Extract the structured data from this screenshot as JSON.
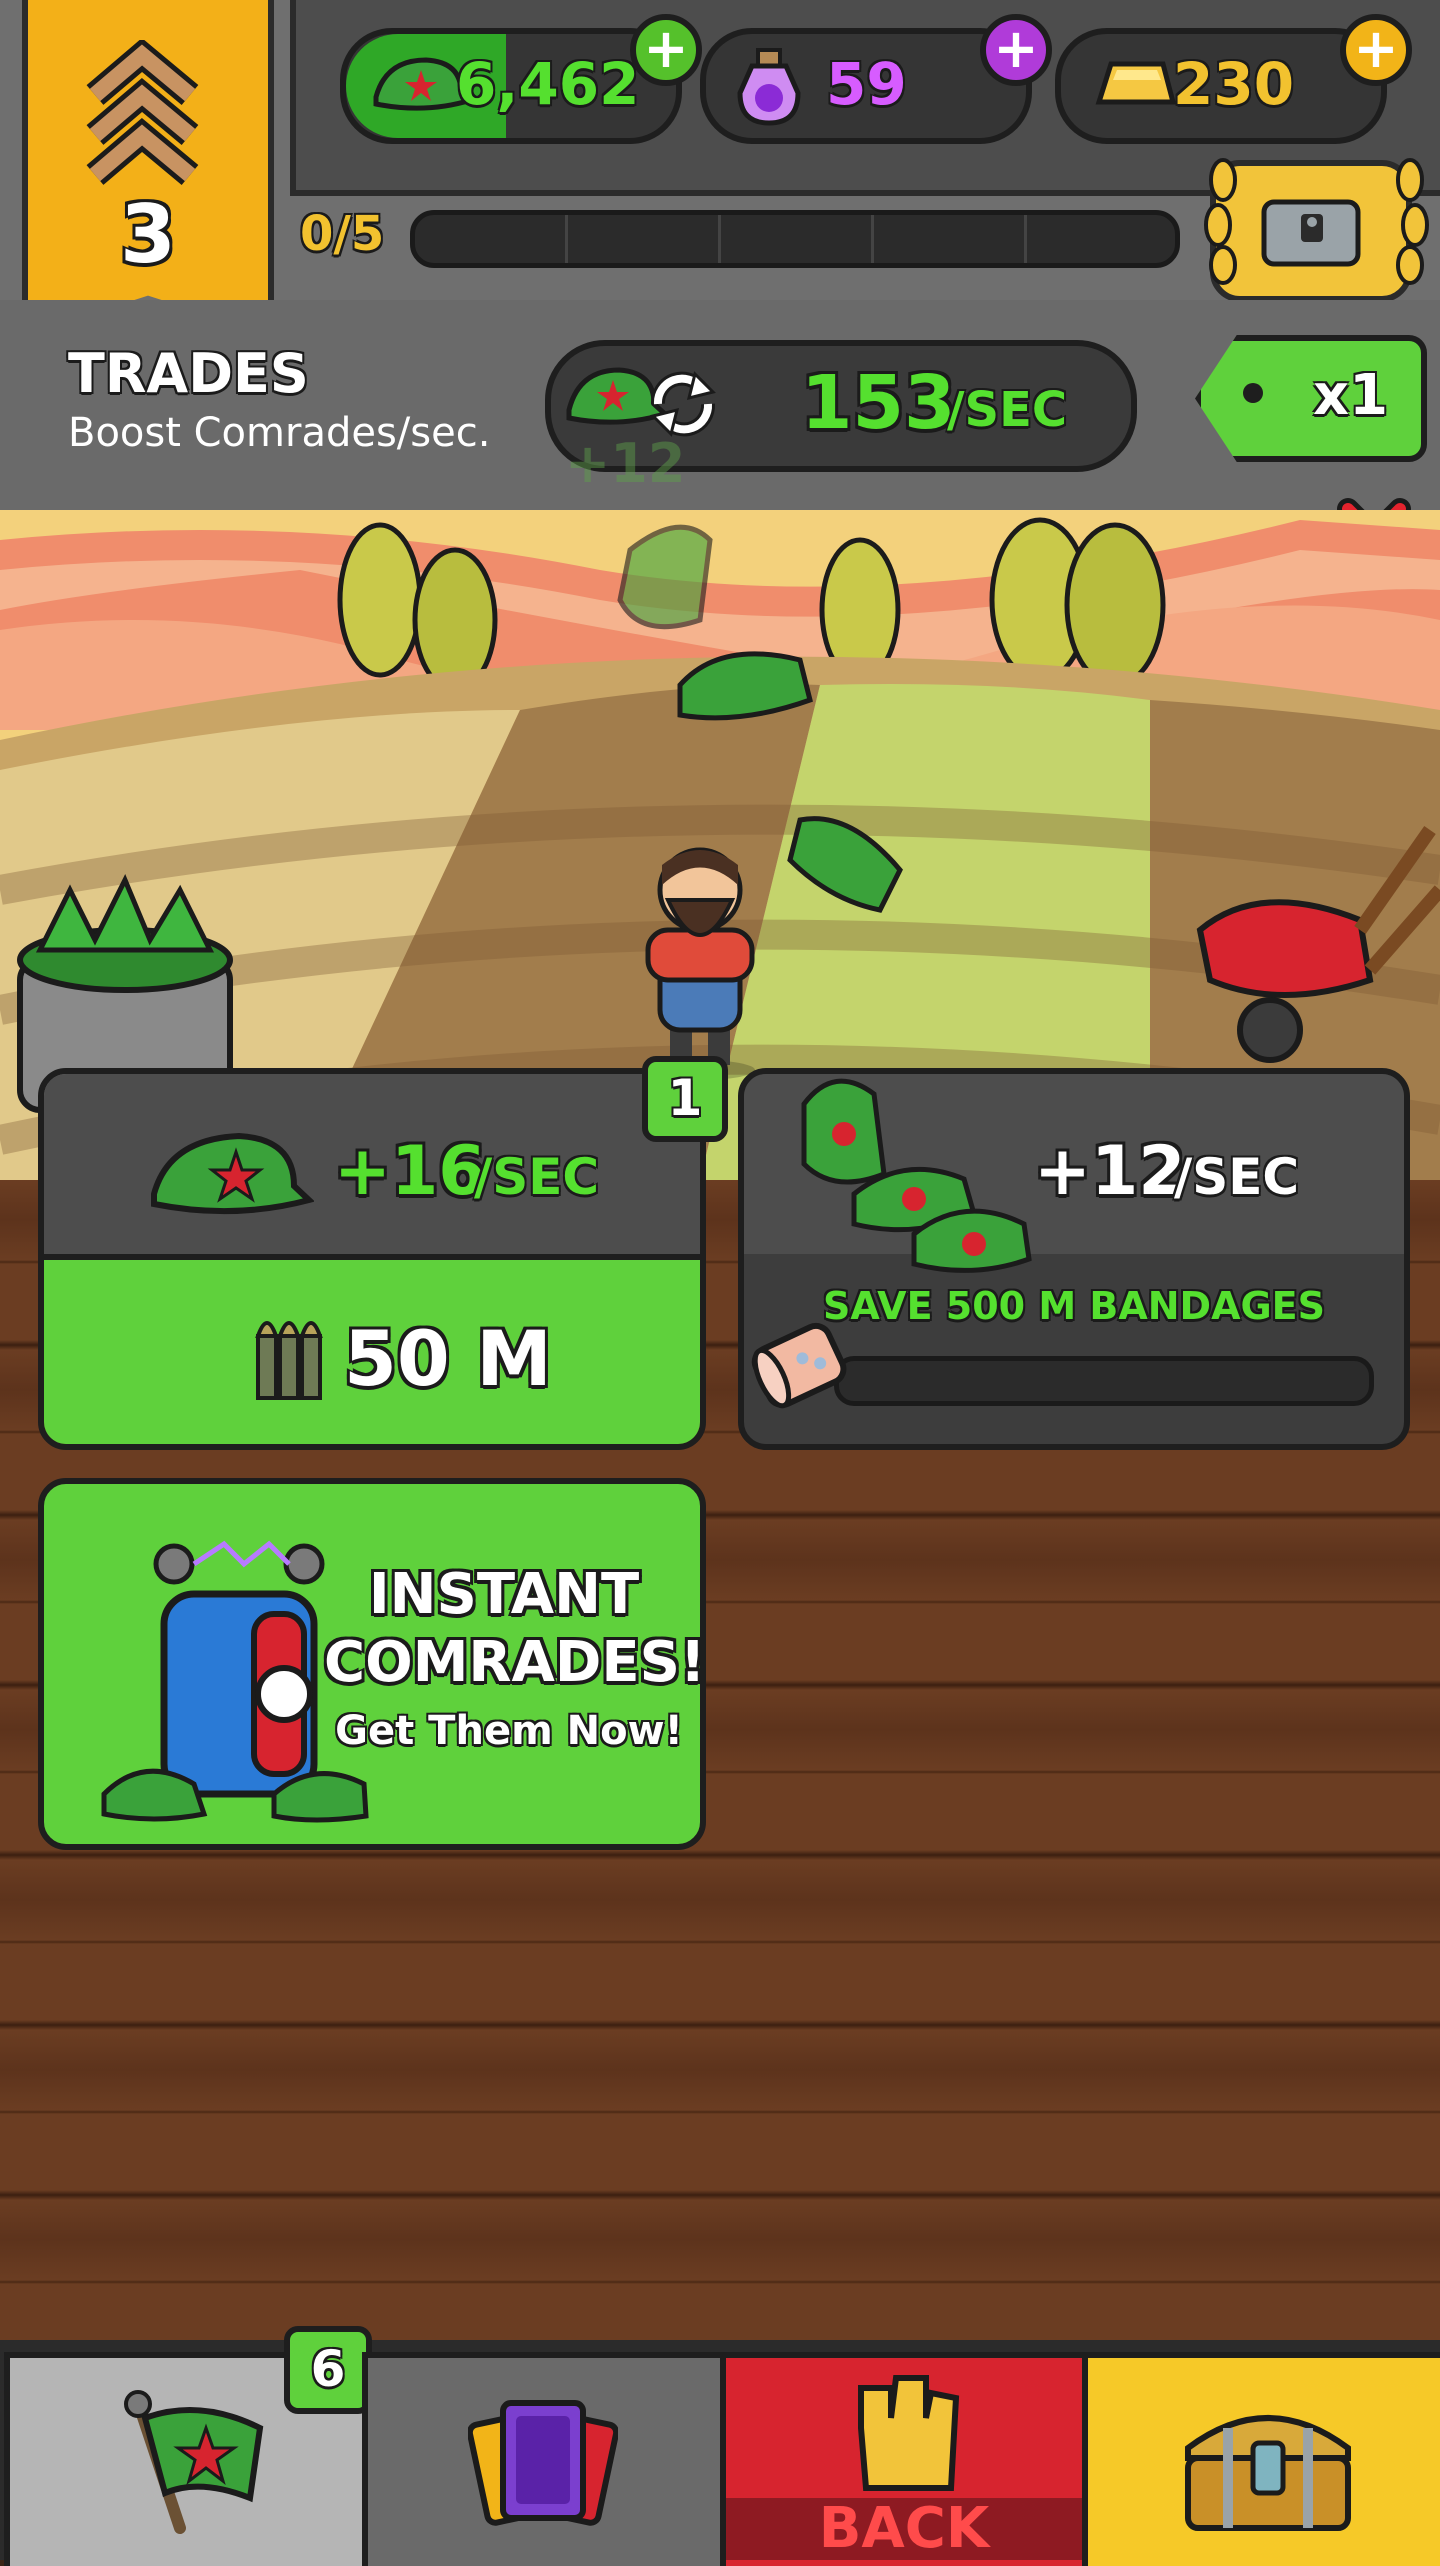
{
  "hud": {
    "rank_level": "3",
    "progress_text": "0/5",
    "progress_fraction": 0.0,
    "currencies": [
      {
        "name": "comrades",
        "icon": "green-cap-icon",
        "value": "6,462",
        "color": "#55e02f"
      },
      {
        "name": "potions",
        "icon": "purple-potion-icon",
        "value": "59",
        "color": "#d75cff"
      },
      {
        "name": "gold",
        "icon": "gold-bar-icon",
        "value": "230",
        "color": "#f2c22f"
      }
    ]
  },
  "trades": {
    "title": "TRADES",
    "subtitle": "Boost Comrades/sec.",
    "rate_value": "153",
    "rate_unit": "/SEC",
    "multiplier": "x1",
    "floating_gain": "+12"
  },
  "cards": {
    "upgrade": {
      "badge": "1",
      "rate_value": "+16",
      "rate_unit": "/SEC",
      "cost": "50 M"
    },
    "bandages": {
      "rate_value": "+12",
      "rate_unit": "/SEC",
      "goal_text": "SAVE 500 M BANDAGES",
      "progress_fraction": 0.0
    },
    "instant": {
      "title_line1": "INSTANT",
      "title_line2": "COMRADES!",
      "subtitle": "Get Them Now!"
    }
  },
  "nav": {
    "flag_badge": "6",
    "back_label": "BACK"
  },
  "colors": {
    "accent_green": "#5fd13c",
    "text_green": "#55e02f",
    "panel_gray": "#4d4d4d",
    "back_red": "#d7242f",
    "gold_tab": "#f6c928"
  }
}
